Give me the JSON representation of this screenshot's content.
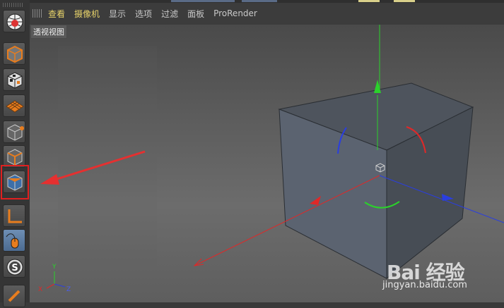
{
  "menu": {
    "items": [
      {
        "label": "查看",
        "highlight": true
      },
      {
        "label": "摄像机",
        "highlight": true
      },
      {
        "label": "显示",
        "highlight": false
      },
      {
        "label": "选项",
        "highlight": false
      },
      {
        "label": "过滤",
        "highlight": false
      },
      {
        "label": "面板",
        "highlight": false
      },
      {
        "label": "ProRender",
        "highlight": false
      }
    ]
  },
  "viewport": {
    "label": "透视视图",
    "axes": {
      "y": "Y",
      "x": "X",
      "z": "Z"
    }
  },
  "watermark": {
    "main": "Bai 经验",
    "sub": "jingyan.baidu.com"
  },
  "colors": {
    "accent": "#e87d1e",
    "highlight": "#e02020",
    "axis_x": "#e02828",
    "axis_y": "#2bd12b",
    "axis_z": "#2a3ee0"
  }
}
